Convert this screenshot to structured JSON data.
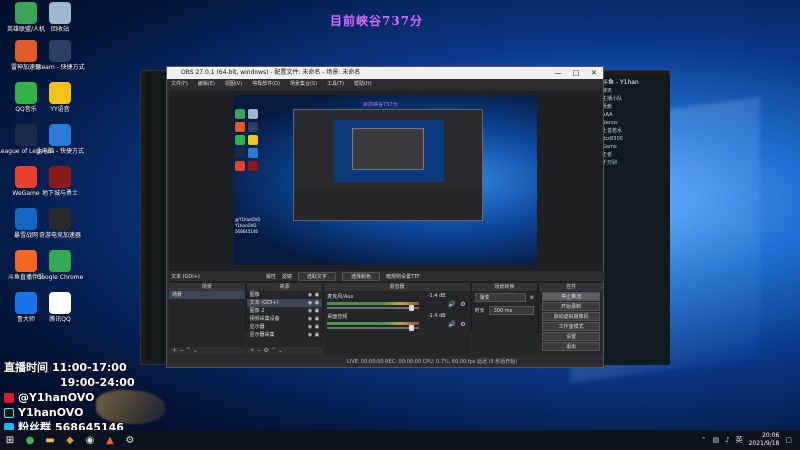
{
  "countdown": "目前峡谷737分",
  "desktop_icons": [
    {
      "label": "英雄联盟/人机",
      "color": "#3aa655"
    },
    {
      "label": "回收站",
      "color": "#9fb6cc"
    },
    {
      "label": "雷神加速器",
      "color": "#e05a2a"
    },
    {
      "label": "Steam - 快捷方式",
      "color": "#2a3f63"
    },
    {
      "label": "QQ音乐",
      "color": "#32b34a"
    },
    {
      "label": "YY语音",
      "color": "#f2c21b"
    },
    {
      "label": "League of Legends",
      "color": "#1b2b4a"
    },
    {
      "label": "此电脑 - 快捷方式",
      "color": "#2e7bd6"
    },
    {
      "label": "WeGame",
      "color": "#e8402f"
    },
    {
      "label": "地下城与勇士",
      "color": "#8a1b1b"
    },
    {
      "label": "暴雪战网",
      "color": "#1666c8"
    },
    {
      "label": "奇游电竞加速器",
      "color": "#2a2a2a"
    },
    {
      "label": "斗鱼直播伴侣",
      "color": "#f26522"
    },
    {
      "label": "Google Chrome",
      "color": "#34a853"
    },
    {
      "label": "鲁大师",
      "color": "#1a73e8"
    },
    {
      "label": "腾讯QQ",
      "color": "#ffffff"
    }
  ],
  "obs": {
    "title": "OBS 27.0.1 (64-bit, windows) - 配置文件: 未命名 - 场景: 未命名",
    "menu": [
      "文件(F)",
      "编辑(E)",
      "视图(V)",
      "停靠部件(D)",
      "场景集合(S)",
      "工具(T)",
      "帮助(H)"
    ],
    "scene_strip": {
      "label": "文本 (GDI+)",
      "properties": "属性",
      "filters": "滤镜",
      "btn1": "选取文字",
      "btn2": "选择颜色",
      "note": "暗规则设置TTF"
    },
    "scenes_title": "场景",
    "scenes": [
      "场景"
    ],
    "sources_title": "来源",
    "sources": [
      "图像",
      "文本 (GDI+)",
      "图像 2",
      "视频采集设备",
      "显示器",
      "显示器采集"
    ],
    "mixer_title": "混音器",
    "mixer": [
      {
        "name": "麦克风/Aux",
        "db": "-1.4 dB"
      },
      {
        "name": "桌面音频",
        "db": "-1.4 dB"
      }
    ],
    "transitions_title": "场景转换",
    "transition_type": "渐变",
    "duration_label": "时长",
    "duration_value": "300 ms",
    "controls_title": "控件",
    "controls": [
      "停止推流",
      "开始录制",
      "启动虚拟摄像机",
      "工作室模式",
      "设置",
      "退出"
    ],
    "status": "LIVE: 00:00:00   REC: 00:00:00   CPU: 0.7%, 60.00 fps   延迟 (5 秒后开始)"
  },
  "chat_panel": {
    "streamer": "斗鱼 - Y1han",
    "lines": [
      "聊天",
      "主播小队",
      "贡献",
      "AAA",
      "Nanos",
      "上善若水",
      "tbx8300",
      "Game",
      "王者",
      "千万别"
    ]
  },
  "schedule": {
    "time_label": "直播时间",
    "time1": "11:00-17:00",
    "time2": "19:00-24:00",
    "weibo": "@Y1hanOVO",
    "douyin": "Y1hanOVO",
    "fans_label": "粉丝群",
    "fans_number": "568645146"
  },
  "taskbar": {
    "time": "20:06",
    "date": "2021/9/18",
    "lang": "英"
  },
  "colors": {
    "accent": "#d56bff",
    "obs_bg": "#2a2a2e",
    "taskbar": "#0c1220"
  }
}
